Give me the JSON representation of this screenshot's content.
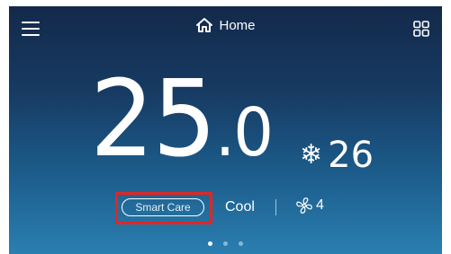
{
  "header": {
    "title": "Home"
  },
  "temperature": {
    "current_int": "25",
    "current_dec": ".0",
    "set_point": "26"
  },
  "status": {
    "smart_care_label": "Smart Care",
    "mode": "Cool",
    "fan_speed": "4"
  },
  "pager": {
    "count": 3,
    "active_index": 0
  },
  "icons": {
    "menu": "hamburger-menu-icon",
    "home": "home-icon",
    "grid": "grid-icon",
    "mode": "snowflake-icon",
    "fan": "fan-icon"
  },
  "colors": {
    "highlight": "#e32622",
    "text": "#ffffff"
  }
}
